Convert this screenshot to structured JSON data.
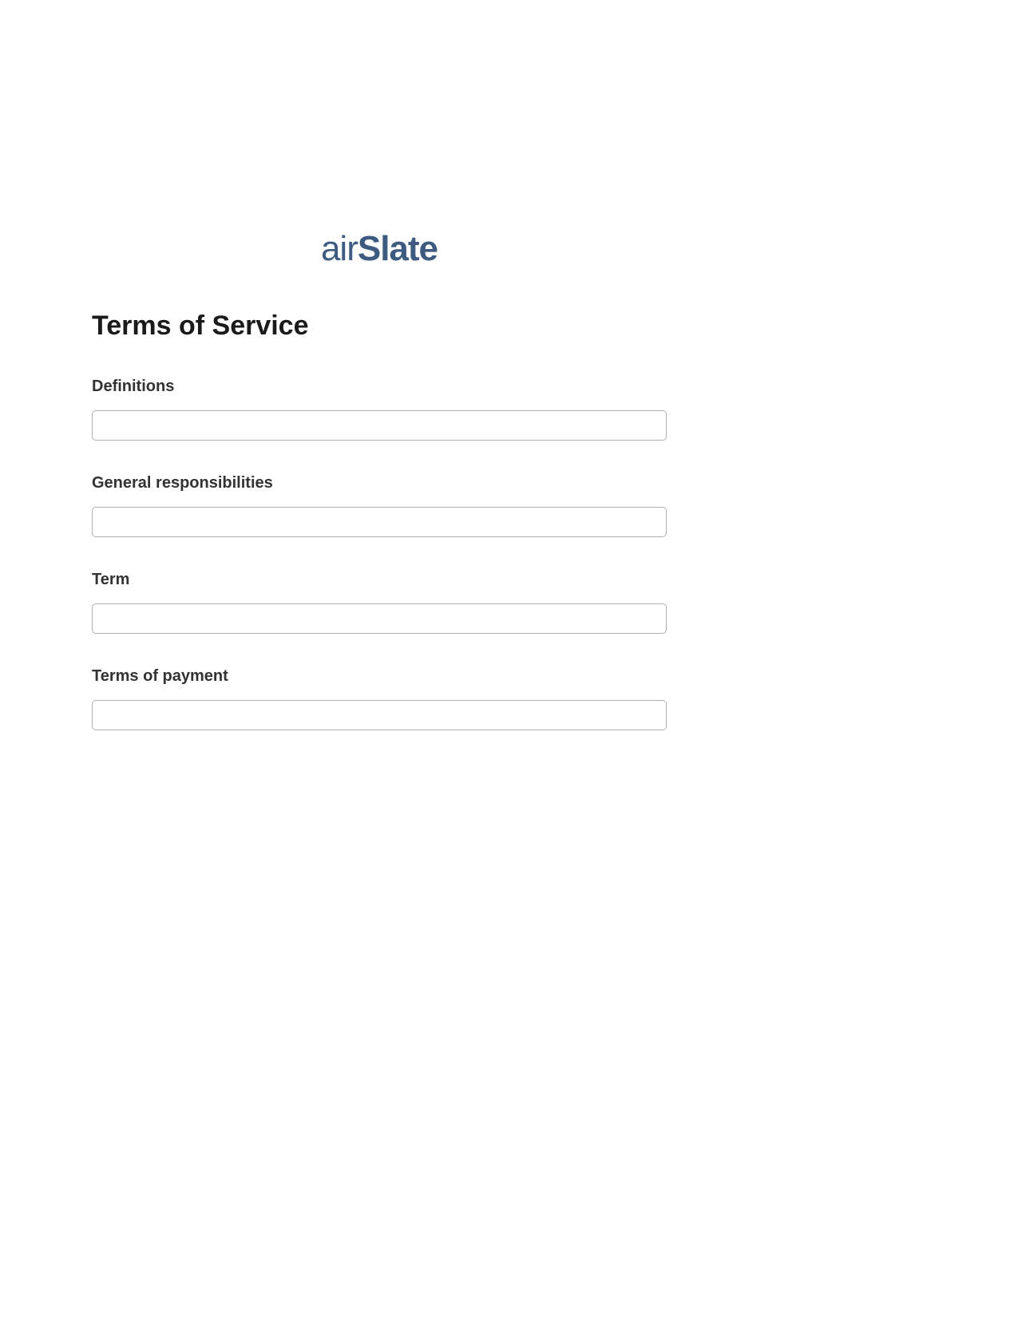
{
  "brand": {
    "part1": "air",
    "part2": "Slate"
  },
  "title": "Terms of Service",
  "fields": [
    {
      "label": "Definitions",
      "value": ""
    },
    {
      "label": "General responsibilities",
      "value": ""
    },
    {
      "label": "Term",
      "value": ""
    },
    {
      "label": "Terms of payment",
      "value": ""
    }
  ]
}
